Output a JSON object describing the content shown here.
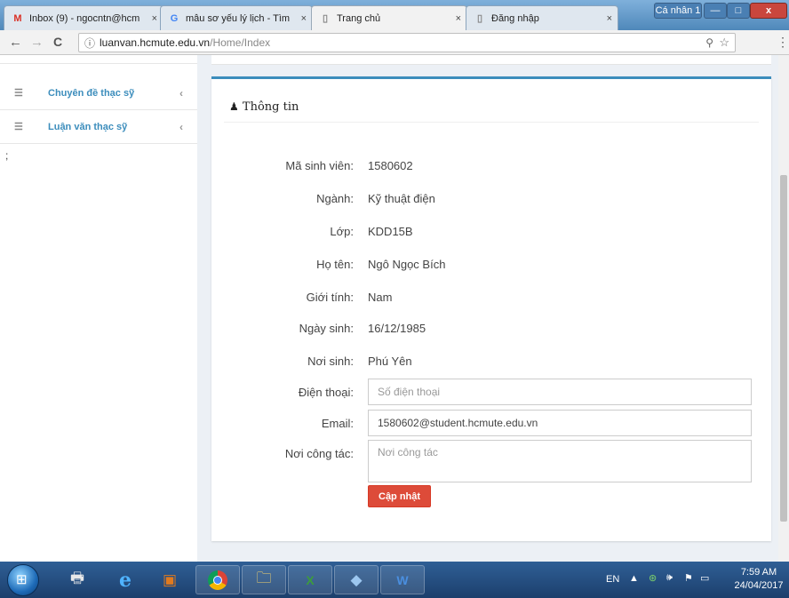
{
  "browser": {
    "tabs": [
      {
        "title": "Inbox (9) - ngocntn@hcm",
        "icon": "gmail-icon",
        "close": "×"
      },
      {
        "title": "mẫu sơ yếu lý lịch - Tìm",
        "icon": "google-icon",
        "close": "×"
      },
      {
        "title": "Trang chủ",
        "icon": "page-icon",
        "close": "×"
      },
      {
        "title": "Đăng nhập",
        "icon": "page-icon",
        "close": "×"
      }
    ],
    "profile_label": "Cá nhân 1",
    "window_buttons": {
      "minimize": "—",
      "maximize": "□",
      "close": "x"
    },
    "url_host": "luanvan.hcmute.edu.vn",
    "url_path": "/Home/Index",
    "nav": {
      "back": "←",
      "forward": "→",
      "reload": "C",
      "info": "ⓘ"
    }
  },
  "sidebar": {
    "items": [
      {
        "label": "Chuyên đề thạc sỹ",
        "icon": "list-icon"
      },
      {
        "label": "Luận văn thạc sỹ",
        "icon": "list-icon"
      }
    ],
    "stray_char": ";"
  },
  "card": {
    "title": "Thông tin",
    "fields": {
      "student_id": {
        "label": "Mã sinh viên:",
        "value": "1580602"
      },
      "major": {
        "label": "Ngành:",
        "value": "Kỹ thuật điện"
      },
      "class": {
        "label": "Lớp:",
        "value": "KDD15B"
      },
      "full_name": {
        "label": "Họ tên:",
        "value": "Ngô Ngọc Bích"
      },
      "gender": {
        "label": "Giới tính:",
        "value": "Nam"
      },
      "birth_date": {
        "label": "Ngày sinh:",
        "value": "16/12/1985"
      },
      "birth_place": {
        "label": "Nơi sinh:",
        "value": "Phú Yên"
      },
      "phone": {
        "label": "Điện thoại:",
        "value": "",
        "placeholder": "Số điện thoại"
      },
      "email": {
        "label": "Email:",
        "value": "1580602@student.hcmute.edu.vn",
        "placeholder": ""
      },
      "workplace": {
        "label": "Nơi công tác:",
        "value": "",
        "placeholder": "Nơi công tác"
      }
    },
    "update_label": "Cập nhật"
  },
  "taskbar": {
    "language": "EN",
    "time": "7:59 AM",
    "date": "24/04/2017"
  },
  "colors": {
    "accent": "#3c8dbc",
    "danger": "#dd4b39"
  }
}
